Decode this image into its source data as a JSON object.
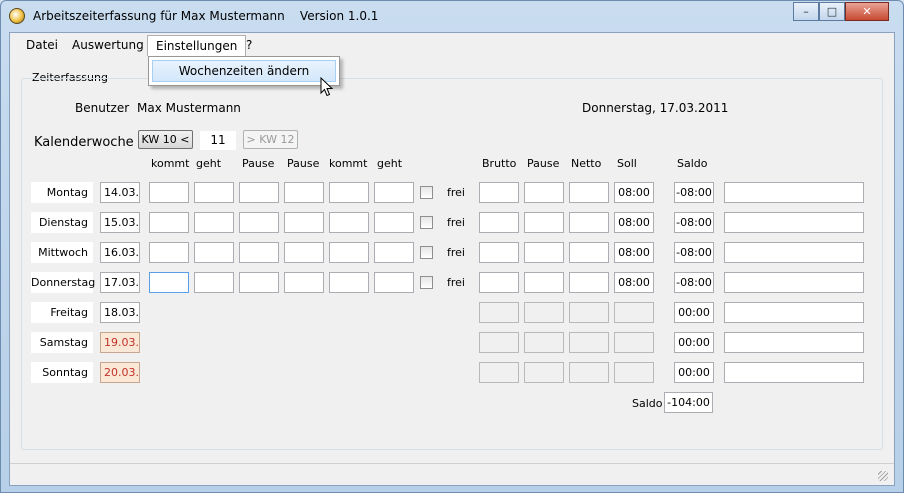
{
  "window": {
    "title": "Arbeitszeiterfassung für Max Mustermann    Version 1.0.1",
    "minimize": "–",
    "maximize": "□",
    "close": "✕"
  },
  "menu": {
    "items": [
      "Datei",
      "Auswertung",
      "Einstellungen",
      "?"
    ],
    "open_menu": "Einstellungen",
    "dropdown": [
      "Wochenzeiten ändern"
    ]
  },
  "group_title": "Zeiterfassung",
  "user": {
    "label": "Benutzer",
    "name": "Max Mustermann"
  },
  "date_display": "Donnerstag, 17.03.2011",
  "week": {
    "label": "Kalenderwoche",
    "prev_button": "KW 10 <",
    "current": "11",
    "next_button": "> KW 12"
  },
  "headers": {
    "left": [
      "kommt",
      "geht",
      "Pause",
      "Pause",
      "kommt",
      "geht"
    ],
    "right": [
      "Brutto",
      "Pause",
      "Netto",
      "Soll",
      "Saldo"
    ]
  },
  "frei_label": "frei",
  "days": [
    {
      "name": "Montag",
      "date": "14.03.",
      "soll": "08:00",
      "saldo": "-08:00",
      "weekend": false,
      "editable": true
    },
    {
      "name": "Dienstag",
      "date": "15.03.",
      "soll": "08:00",
      "saldo": "-08:00",
      "weekend": false,
      "editable": true
    },
    {
      "name": "Mittwoch",
      "date": "16.03.",
      "soll": "08:00",
      "saldo": "-08:00",
      "weekend": false,
      "editable": true
    },
    {
      "name": "Donnerstag",
      "date": "17.03.",
      "soll": "08:00",
      "saldo": "-08:00",
      "weekend": false,
      "editable": true
    },
    {
      "name": "Freitag",
      "date": "18.03.",
      "soll": "",
      "saldo": "00:00",
      "weekend": false,
      "editable": false
    },
    {
      "name": "Samstag",
      "date": "19.03.",
      "soll": "",
      "saldo": "00:00",
      "weekend": true,
      "editable": false
    },
    {
      "name": "Sonntag",
      "date": "20.03.",
      "soll": "",
      "saldo": "00:00",
      "weekend": true,
      "editable": false
    }
  ],
  "total": {
    "label": "Saldo",
    "value": "-104:00"
  },
  "colors": {
    "weekend_bg": "#fbe7d6",
    "weekend_text": "#c0302a",
    "menu_highlight": "#d3e7fb"
  }
}
